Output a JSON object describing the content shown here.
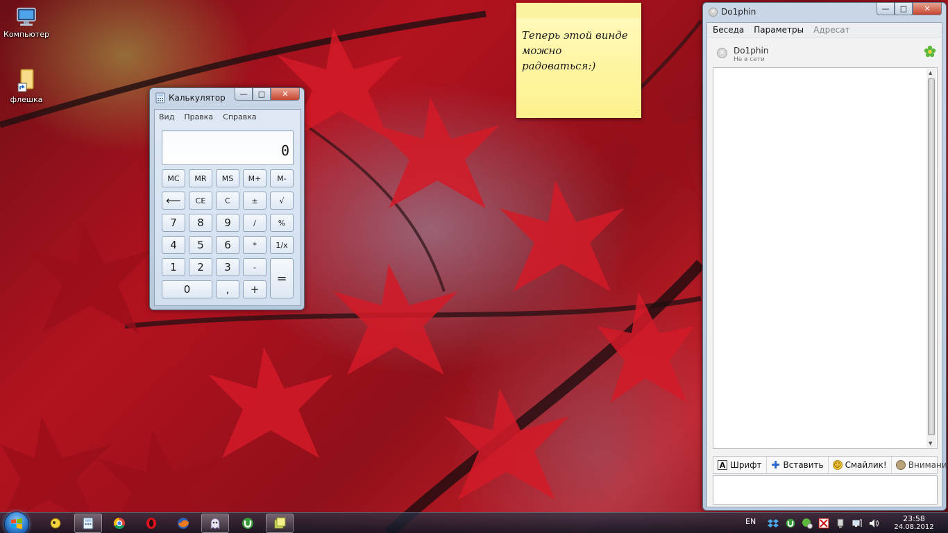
{
  "desktop": {
    "icons": [
      {
        "label": "Компьютер"
      },
      {
        "label": "флешка"
      }
    ]
  },
  "sticky_note": {
    "line1": "Теперь этой винде",
    "line2": "можно радоваться:)"
  },
  "calculator": {
    "title": "Калькулятор",
    "menu": [
      "Вид",
      "Правка",
      "Справка"
    ],
    "display": "0",
    "memory_row": [
      "MC",
      "MR",
      "MS",
      "M+",
      "M-"
    ],
    "row2": [
      "⟵",
      "CE",
      "C",
      "±",
      "√"
    ],
    "row3": [
      "7",
      "8",
      "9",
      "/",
      "%"
    ],
    "row4": [
      "4",
      "5",
      "6",
      "*",
      "1/x"
    ],
    "row5": [
      "1",
      "2",
      "3",
      "-"
    ],
    "row6": [
      "0",
      ",",
      "+"
    ],
    "equals": "="
  },
  "messenger": {
    "title": "Do1phin",
    "menu": [
      "Беседа",
      "Параметры",
      "Адресат"
    ],
    "contact": {
      "name": "Do1phin",
      "status": "Не в сети"
    },
    "toolbar": [
      {
        "icon": "font-icon",
        "label": "Шрифт"
      },
      {
        "icon": "insert-icon",
        "label": "Вставить"
      },
      {
        "icon": "smiley-icon",
        "label": "Смайлик!"
      },
      {
        "icon": "attention-icon",
        "label": "Внимание!"
      }
    ]
  },
  "taskbar": {
    "language": "EN",
    "time": "23:58",
    "date": "24.08.2012"
  }
}
